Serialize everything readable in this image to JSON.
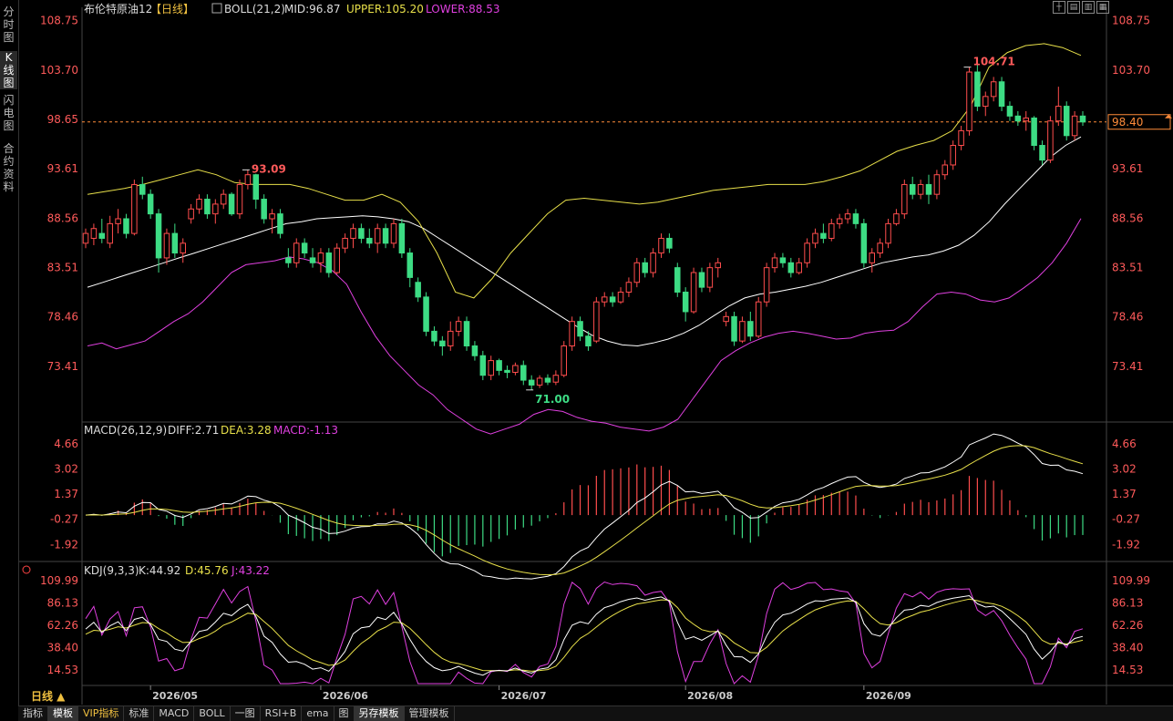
{
  "sidebar": {
    "tabs": [
      "分时图",
      "K线图",
      "闪电图",
      "合约资料"
    ],
    "active": 1
  },
  "main_panel": {
    "symbol_title": "布伦特原油12",
    "period_tag": "【日线】",
    "indicator": "BOLL(21,2)",
    "mid": "MID:96.87",
    "upper": "UPPER:105.20",
    "lower": "LOWER:88.53",
    "price_ticks": [
      "108.75",
      "103.70",
      "98.65",
      "93.61",
      "88.56",
      "83.51",
      "78.46",
      "73.41"
    ],
    "current_price": "98.40",
    "high_label": "104.71",
    "mid_high_label": "93.09",
    "low_label": "71.00"
  },
  "macd_panel": {
    "indicator": "MACD(26,12,9)",
    "diff": "DIFF:2.71",
    "dea": "DEA:3.28",
    "macd": "MACD:-1.13",
    "ticks": [
      "4.66",
      "3.02",
      "1.37",
      "-0.27",
      "-1.92"
    ]
  },
  "kdj_panel": {
    "indicator": "KDJ(9,3,3)",
    "k": "K:44.92",
    "d": "D:45.76",
    "j": "J:43.22",
    "ticks": [
      "109.99",
      "86.13",
      "62.26",
      "38.40",
      "14.53"
    ]
  },
  "x_axis": {
    "period_label": "日线 ▲",
    "months": [
      "2026/05",
      "2026/06",
      "2026/07",
      "2026/08",
      "2026/09"
    ]
  },
  "bottom_tabs": [
    "指标",
    "模板",
    "VIP指标",
    "标准",
    "MACD",
    "BOLL",
    "一图",
    "RSI+B",
    "ema",
    "图",
    "另存模板",
    "管理模板"
  ],
  "colors": {
    "up": "#ff4d4d",
    "down": "#3ddc84",
    "mid": "#ffffff",
    "upper": "#e8e04a",
    "lower": "#e040e0",
    "dash": "#ff8c3a"
  },
  "chart_data": {
    "type": "candlestick",
    "x_start": "2026-04-22",
    "x_end": "2026-09-26",
    "price_ylim": [
      68,
      109
    ],
    "ohlc": [
      [
        86.0,
        87.5,
        85.5,
        87.0
      ],
      [
        86.5,
        88.0,
        85.8,
        87.5
      ],
      [
        87.0,
        88.5,
        86.0,
        86.5
      ],
      [
        86.0,
        88.8,
        85.5,
        88.0
      ],
      [
        88.0,
        89.5,
        87.0,
        88.5
      ],
      [
        88.5,
        89.0,
        86.5,
        87.0
      ],
      [
        87.0,
        92.5,
        86.8,
        92.0
      ],
      [
        92.0,
        92.8,
        90.5,
        91.0
      ],
      [
        91.0,
        91.5,
        88.5,
        89.0
      ],
      [
        89.0,
        89.5,
        83.0,
        84.5
      ],
      [
        84.5,
        87.5,
        83.8,
        87.0
      ],
      [
        87.0,
        88.0,
        84.5,
        85.0
      ],
      [
        85.0,
        86.5,
        84.0,
        86.0
      ],
      [
        88.5,
        90.0,
        88.0,
        89.5
      ],
      [
        89.5,
        91.0,
        89.0,
        90.5
      ],
      [
        90.5,
        91.0,
        88.5,
        89.0
      ],
      [
        89.0,
        90.5,
        88.0,
        90.0
      ],
      [
        90.0,
        91.5,
        89.5,
        91.0
      ],
      [
        91.0,
        91.2,
        88.8,
        89.0
      ],
      [
        89.0,
        92.5,
        88.5,
        92.0
      ],
      [
        92.0,
        93.5,
        91.5,
        93.0
      ],
      [
        93.0,
        93.1,
        89.5,
        90.5
      ],
      [
        90.5,
        91.0,
        88.0,
        88.5
      ],
      [
        88.5,
        89.5,
        87.0,
        89.0
      ],
      [
        89.0,
        89.5,
        86.5,
        87.0
      ],
      [
        84.5,
        85.5,
        83.5,
        84.0
      ],
      [
        84.0,
        86.5,
        83.5,
        86.0
      ],
      [
        86.0,
        86.5,
        84.5,
        85.0
      ],
      [
        84.5,
        85.5,
        83.5,
        84.0
      ],
      [
        84.0,
        85.5,
        83.0,
        85.0
      ],
      [
        85.0,
        85.5,
        82.5,
        83.0
      ],
      [
        83.0,
        86.0,
        82.8,
        85.5
      ],
      [
        85.5,
        87.0,
        85.0,
        86.5
      ],
      [
        86.5,
        88.0,
        85.5,
        87.5
      ],
      [
        87.5,
        88.0,
        86.0,
        86.5
      ],
      [
        86.5,
        87.5,
        85.5,
        86.0
      ],
      [
        86.0,
        88.0,
        85.0,
        87.5
      ],
      [
        87.5,
        88.0,
        85.5,
        86.0
      ],
      [
        86.0,
        88.5,
        85.5,
        88.0
      ],
      [
        88.0,
        88.5,
        84.5,
        85.0
      ],
      [
        85.0,
        85.5,
        81.5,
        82.5
      ],
      [
        82.0,
        82.5,
        80.0,
        80.5
      ],
      [
        80.5,
        81.0,
        76.5,
        77.0
      ],
      [
        77.0,
        77.5,
        75.5,
        76.0
      ],
      [
        76.0,
        76.5,
        74.5,
        75.5
      ],
      [
        75.5,
        78.0,
        75.0,
        77.0
      ],
      [
        77.0,
        78.5,
        76.5,
        78.0
      ],
      [
        78.0,
        78.5,
        75.0,
        75.5
      ],
      [
        75.5,
        76.0,
        74.0,
        74.5
      ],
      [
        74.5,
        75.0,
        72.0,
        72.5
      ],
      [
        72.5,
        74.5,
        72.0,
        74.0
      ],
      [
        74.0,
        74.2,
        72.5,
        73.0
      ],
      [
        73.0,
        73.5,
        72.2,
        72.8
      ],
      [
        72.8,
        73.8,
        72.5,
        73.5
      ],
      [
        73.5,
        74.0,
        71.5,
        72.0
      ],
      [
        72.0,
        72.5,
        71.0,
        71.5
      ],
      [
        71.5,
        72.5,
        71.2,
        72.2
      ],
      [
        72.2,
        72.6,
        71.5,
        71.8
      ],
      [
        71.8,
        73.0,
        71.5,
        72.5
      ],
      [
        72.5,
        76.0,
        72.3,
        75.5
      ],
      [
        75.5,
        78.5,
        75.0,
        78.0
      ],
      [
        78.0,
        78.5,
        76.0,
        76.5
      ],
      [
        76.5,
        77.0,
        75.0,
        75.5
      ],
      [
        76.0,
        80.5,
        75.8,
        80.0
      ],
      [
        80.0,
        81.0,
        79.5,
        80.5
      ],
      [
        80.5,
        81.0,
        79.5,
        80.0
      ],
      [
        80.0,
        81.5,
        79.8,
        81.0
      ],
      [
        81.0,
        82.5,
        80.5,
        82.0
      ],
      [
        82.0,
        84.5,
        81.5,
        84.0
      ],
      [
        84.0,
        84.5,
        82.5,
        83.0
      ],
      [
        83.0,
        85.5,
        82.5,
        85.0
      ],
      [
        85.0,
        87.0,
        84.5,
        86.5
      ],
      [
        86.5,
        87.0,
        85.0,
        85.5
      ],
      [
        83.5,
        84.0,
        80.5,
        81.0
      ],
      [
        81.0,
        81.5,
        78.0,
        79.0
      ],
      [
        79.0,
        83.5,
        78.8,
        83.0
      ],
      [
        83.0,
        83.5,
        81.0,
        81.5
      ],
      [
        81.5,
        84.0,
        81.0,
        83.5
      ],
      [
        83.5,
        84.5,
        82.5,
        84.0
      ],
      [
        78.0,
        79.0,
        77.5,
        78.5
      ],
      [
        78.5,
        79.0,
        75.5,
        76.0
      ],
      [
        76.0,
        78.5,
        75.8,
        78.0
      ],
      [
        78.0,
        79.0,
        76.0,
        76.5
      ],
      [
        76.5,
        80.5,
        76.3,
        80.0
      ],
      [
        80.0,
        84.0,
        79.5,
        83.5
      ],
      [
        83.5,
        85.0,
        83.0,
        84.5
      ],
      [
        84.5,
        85.0,
        83.5,
        84.0
      ],
      [
        84.0,
        84.5,
        82.5,
        83.0
      ],
      [
        83.0,
        84.5,
        82.8,
        84.0
      ],
      [
        84.0,
        86.5,
        83.5,
        86.0
      ],
      [
        86.0,
        87.5,
        85.5,
        87.0
      ],
      [
        87.0,
        88.0,
        86.0,
        86.5
      ],
      [
        86.5,
        88.5,
        86.2,
        88.0
      ],
      [
        88.0,
        89.0,
        87.5,
        88.5
      ],
      [
        88.5,
        89.5,
        88.0,
        89.0
      ],
      [
        89.0,
        89.5,
        87.5,
        88.0
      ],
      [
        88.0,
        88.5,
        83.5,
        84.0
      ],
      [
        84.0,
        85.5,
        83.0,
        85.0
      ],
      [
        85.0,
        86.5,
        84.5,
        86.0
      ],
      [
        86.0,
        88.5,
        85.5,
        88.0
      ],
      [
        88.0,
        89.5,
        87.8,
        89.0
      ],
      [
        89.0,
        92.5,
        88.5,
        92.0
      ],
      [
        92.0,
        92.8,
        90.5,
        91.0
      ],
      [
        91.0,
        92.5,
        90.5,
        92.0
      ],
      [
        92.0,
        93.0,
        90.0,
        91.0
      ],
      [
        91.0,
        93.5,
        90.5,
        93.0
      ],
      [
        93.0,
        94.5,
        92.5,
        94.0
      ],
      [
        94.0,
        96.5,
        93.5,
        96.0
      ],
      [
        96.0,
        98.0,
        95.5,
        97.5
      ],
      [
        97.5,
        104.0,
        97.0,
        103.5
      ],
      [
        103.5,
        104.71,
        99.5,
        100.0
      ],
      [
        100.0,
        101.5,
        99.0,
        101.0
      ],
      [
        101.0,
        103.0,
        100.5,
        102.5
      ],
      [
        102.5,
        103.0,
        99.5,
        100.0
      ],
      [
        100.0,
        100.5,
        98.5,
        99.0
      ],
      [
        99.0,
        99.5,
        98.0,
        98.5
      ],
      [
        98.5,
        99.5,
        97.5,
        98.8
      ],
      [
        98.8,
        99.0,
        95.5,
        96.0
      ],
      [
        96.0,
        96.5,
        94.0,
        94.5
      ],
      [
        94.5,
        99.0,
        94.2,
        98.5
      ],
      [
        98.5,
        102.0,
        98.0,
        100.0
      ],
      [
        100.0,
        100.5,
        96.5,
        97.0
      ],
      [
        97.0,
        99.5,
        96.5,
        99.0
      ],
      [
        99.0,
        99.5,
        98.0,
        98.4
      ]
    ],
    "boll_mid": [
      81.5,
      82,
      82.5,
      83,
      83.5,
      84,
      84.5,
      85,
      85.5,
      86,
      86.5,
      87,
      87.5,
      88,
      88.2,
      88.5,
      88.6,
      88.7,
      88.8,
      88.7,
      88.5,
      88.2,
      87.5,
      86.5,
      85.5,
      84.5,
      83.5,
      82.5,
      81.5,
      80.5,
      79.5,
      78.5,
      77.5,
      76.6,
      76,
      75.6,
      75.5,
      75.8,
      76.2,
      76.8,
      77.6,
      78.6,
      79.6,
      80.4,
      80.8,
      81,
      81.3,
      81.6,
      82,
      82.5,
      83,
      83.5,
      84,
      84.3,
      84.6,
      84.8,
      85.2,
      85.8,
      86.8,
      88.2,
      90,
      91.6,
      93.2,
      94.8,
      96,
      96.87
    ],
    "boll_upper": [
      91,
      91.3,
      91.6,
      92,
      92.5,
      93,
      93.5,
      93,
      92.2,
      92,
      92,
      92,
      91.6,
      91,
      90.4,
      90.4,
      91,
      90.2,
      88.2,
      85,
      81,
      80.4,
      82.4,
      85,
      87,
      89,
      90.4,
      90.6,
      90.4,
      90.2,
      90,
      90.2,
      90.6,
      91,
      91.4,
      91.6,
      91.8,
      92,
      92,
      92,
      92.3,
      92.8,
      93.4,
      94.4,
      95.4,
      96,
      96.5,
      97.5,
      100,
      104,
      105.5,
      106.2,
      106.4,
      106,
      105.2
    ],
    "boll_lower": [
      75.5,
      75.8,
      75.2,
      75.6,
      76,
      77,
      78,
      78.8,
      80,
      81.5,
      83,
      83.8,
      84,
      84.2,
      84.6,
      84.4,
      84,
      83.2,
      81.8,
      79,
      76.5,
      74.5,
      73,
      71.5,
      70.5,
      69,
      68,
      67,
      66.5,
      67,
      67.5,
      68.5,
      69,
      68.8,
      68.2,
      67.8,
      67.6,
      67.2,
      67,
      66.8,
      67.2,
      68,
      70,
      72,
      74,
      75,
      75.8,
      76.4,
      76.8,
      77,
      76.8,
      76.5,
      76.2,
      76.3,
      76.8,
      77,
      77.1,
      78,
      79.5,
      80.8,
      81,
      80.8,
      80.2,
      80,
      80.4,
      81.4,
      82.5,
      84,
      86,
      88.53
    ],
    "macd": {
      "ylim": [
        -2.8,
        5.2
      ],
      "diff_last": 2.71,
      "dea_last": 3.28,
      "macd_last": -1.13
    },
    "kdj": {
      "ylim": [
        0,
        115
      ],
      "k_last": 44.92,
      "d_last": 45.76,
      "j_last": 43.22
    }
  }
}
